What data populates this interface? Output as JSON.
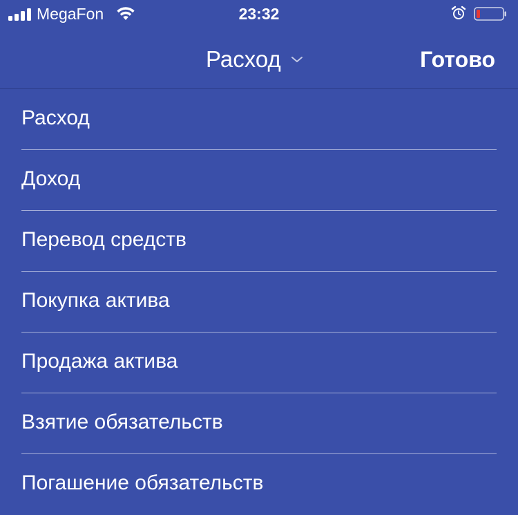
{
  "status_bar": {
    "carrier": "MegaFon",
    "time": "23:32",
    "icons": [
      "signal-icon",
      "wifi-icon",
      "alarm-icon",
      "battery-icon"
    ],
    "battery_color": "#e53935"
  },
  "nav": {
    "title": "Расход",
    "done_label": "Готово"
  },
  "menu": {
    "items": [
      {
        "label": "Расход"
      },
      {
        "label": "Доход"
      },
      {
        "label": "Перевод средств"
      },
      {
        "label": "Покупка актива"
      },
      {
        "label": "Продажа актива"
      },
      {
        "label": "Взятие обязательств"
      },
      {
        "label": "Погашение обязательств"
      }
    ]
  },
  "colors": {
    "background": "#3a4fa9",
    "text": "#ffffff"
  }
}
